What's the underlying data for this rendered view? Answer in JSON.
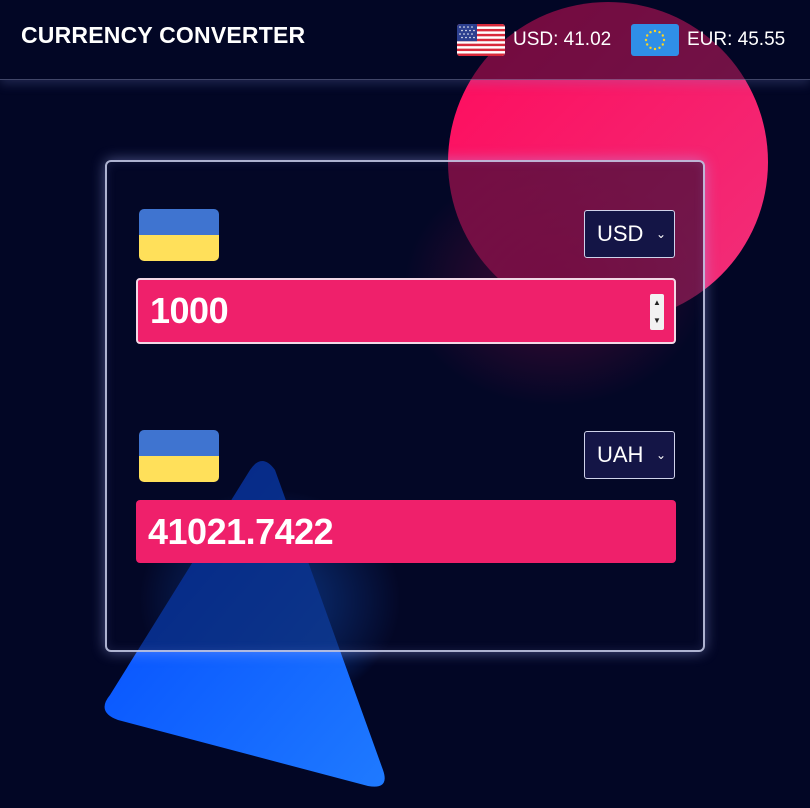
{
  "header": {
    "title": "CURRENCY CONVERTER",
    "rates": [
      {
        "label": "USD: 41.02",
        "flag": "us-flag-icon"
      },
      {
        "label": "EUR: 45.55",
        "flag": "eu-flag-icon"
      }
    ]
  },
  "converter": {
    "from": {
      "currency": "USD",
      "amount": "1000",
      "flag": "ukraine-flag-icon"
    },
    "to": {
      "currency": "UAH",
      "amount": "41021.7422",
      "flag": "ukraine-flag-icon"
    }
  },
  "colors": {
    "background": "#020625",
    "accent_pink": "#ef206b",
    "accent_blue": "#0a5cff",
    "select_bg": "#141546"
  }
}
